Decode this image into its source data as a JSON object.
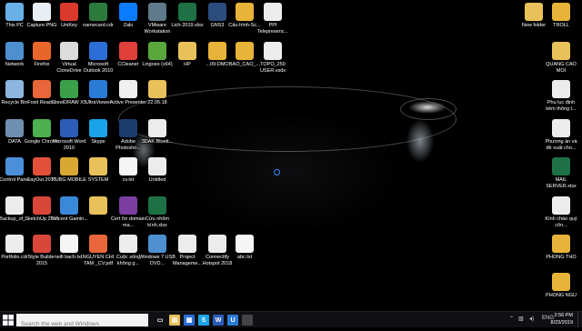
{
  "desktop": {
    "left_column_icons": [
      {
        "label": "This PC",
        "icon": "computer-icon",
        "color": "#6ab0e8"
      },
      {
        "label": "Capture.PNG",
        "icon": "image-file-icon",
        "color": "#e9eef5"
      },
      {
        "label": "UniKey",
        "icon": "unikey-icon",
        "color": "#d93a2b"
      },
      {
        "label": "namecard.cdr",
        "icon": "coreldraw-file-icon",
        "color": "#2d7a3d"
      },
      {
        "label": "Zalo",
        "icon": "zalo-icon",
        "color": "#0a7cff"
      },
      {
        "label": "VMware Workstation",
        "icon": "vmware-icon",
        "color": "#5f7a8a"
      },
      {
        "label": "Lich-2019.xlsx",
        "icon": "excel-file-icon",
        "color": "#1e7145"
      },
      {
        "label": "GNS3",
        "icon": "gns3-icon",
        "color": "#2b4d7e"
      },
      {
        "label": "Cấu-hình-Sc...",
        "icon": "archive-file-icon",
        "color": "#e8b339"
      },
      {
        "label": "PPI Telepresenc...",
        "icon": "document-icon",
        "color": "#ececec"
      },
      {
        "label": "Network",
        "icon": "network-icon",
        "color": "#4e8fd0"
      },
      {
        "label": "Firefox",
        "icon": "firefox-icon",
        "color": "#e8662a"
      },
      {
        "label": "Virtual CloneDrive",
        "icon": "clonedrive-icon",
        "color": "#dcdcdc"
      },
      {
        "label": "Microsoft Outlook 2010",
        "icon": "outlook-icon",
        "color": "#2b6fd6"
      },
      {
        "label": "CCleaner",
        "icon": "ccleaner-icon",
        "color": "#e0403a"
      },
      {
        "label": "Lingoes (x64)",
        "icon": "lingoes-icon",
        "color": "#5aa83b"
      },
      {
        "label": "HP",
        "icon": "folder-icon",
        "color": "#e8c15a"
      },
      {
        "label": "...09-DMO",
        "icon": "archive-file-icon",
        "color": "#e8b339"
      },
      {
        "label": "BAO_CAO_...",
        "icon": "archive-file-icon",
        "color": "#e8b339"
      },
      {
        "label": "TOPO_250 USER.vsdx",
        "icon": "visio-file-icon",
        "color": "#ececec"
      },
      {
        "label": "Recycle Bin",
        "icon": "recycle-bin-icon",
        "color": "#8cb6e0"
      },
      {
        "label": "Foxit Reader",
        "icon": "foxit-reader-icon",
        "color": "#e8663a"
      },
      {
        "label": "CorelDRAW X5",
        "icon": "coreldraw-icon",
        "color": "#3aa04a"
      },
      {
        "label": "UltraViewer",
        "icon": "ultraviewer-icon",
        "color": "#2a7bd6"
      },
      {
        "label": "Active Presenter",
        "icon": "active-presenter-icon",
        "color": "#f0f0f0"
      },
      {
        "label": "22.05.18",
        "icon": "folder-icon",
        "color": "#e8c15a"
      },
      {
        "label": "DATA",
        "icon": "drive-icon",
        "color": "#6f8fb0"
      },
      {
        "label": "Google Chrome",
        "icon": "chrome-icon",
        "color": "#4caf50"
      },
      {
        "label": "Microsoft Word 2010",
        "icon": "word-icon",
        "color": "#2b5cb8"
      },
      {
        "label": "Skype",
        "icon": "skype-icon",
        "color": "#1aa3e8"
      },
      {
        "label": "Adobe Photosho...",
        "icon": "photoshop-icon",
        "color": "#1c3d6e"
      },
      {
        "label": "3DAK Bluett...",
        "icon": "word-file-icon",
        "color": "#ececec"
      },
      {
        "label": "Control Panel",
        "icon": "control-panel-icon",
        "color": "#4b8fd9"
      },
      {
        "label": "LayOut 2015",
        "icon": "layout-icon",
        "color": "#e2503a"
      },
      {
        "label": "PUBG MOBILE",
        "icon": "pubg-icon",
        "color": "#d9a832"
      },
      {
        "label": "SYSTEM",
        "icon": "folder-icon",
        "color": "#e8c15a"
      },
      {
        "label": "cv.txt",
        "icon": "text-file-icon",
        "color": "#f5f5f5"
      },
      {
        "label": "Untitled",
        "icon": "word-file-icon",
        "color": "#ececec"
      },
      {
        "label": "Backup_of_...",
        "icon": "document-icon",
        "color": "#ececec"
      },
      {
        "label": "SketchUp 2015",
        "icon": "sketchup-icon",
        "color": "#d9463a"
      },
      {
        "label": "Tencent Gamin...",
        "icon": "tencent-icon",
        "color": "#3a88d8"
      },
      {
        "label": "",
        "icon": "folder-icon",
        "color": "#e8c15a"
      },
      {
        "label": "Cert for domain ma...",
        "icon": "archive-file-icon",
        "color": "#7a3fa0"
      },
      {
        "label": "Cửu nhôm kính.xlsx",
        "icon": "excel-file-icon",
        "color": "#1e7145"
      },
      {
        "label": "Portfolio.cdr",
        "icon": "coreldraw-file-icon",
        "color": "#ececec"
      },
      {
        "label": "Style Builder 2015",
        "icon": "style-builder-icon",
        "color": "#d9463a"
      },
      {
        "label": "wifi bach.txt",
        "icon": "text-file-icon",
        "color": "#f5f5f5"
      },
      {
        "label": "NGUYEN CHI TAM _CV.pdf",
        "icon": "pdf-file-icon",
        "color": "#e8663a"
      },
      {
        "label": "Cuộc sống không g...",
        "icon": "word-file-icon",
        "color": "#ececec"
      },
      {
        "label": "Windows 7 USB DVD...",
        "icon": "usb-dvd-icon",
        "color": "#4e8fd0"
      },
      {
        "label": "Project Manageme...",
        "icon": "document-icon",
        "color": "#ececec"
      },
      {
        "label": "Connectify Hotspot 2018",
        "icon": "connectify-icon",
        "color": "#ececec"
      },
      {
        "label": "abc.txt",
        "icon": "text-file-icon",
        "color": "#f5f5f5"
      }
    ],
    "right_column_icons": [
      {
        "label": "New folder",
        "icon": "folder-icon",
        "color": "#e8c15a"
      },
      {
        "label": "TROLL",
        "icon": "archive-file-icon",
        "color": "#e8b339"
      },
      {
        "label": "QUANG CAO MOI",
        "icon": "folder-icon",
        "color": "#e8c15a"
      },
      {
        "label": "Phụ lục định kèm thông t...",
        "icon": "word-file-icon",
        "color": "#ececec"
      },
      {
        "label": "Phương án và đề xuất cho...",
        "icon": "word-file-icon",
        "color": "#ececec"
      },
      {
        "label": "MAIL SERVER.xlsx",
        "icon": "excel-file-icon",
        "color": "#1e7145"
      },
      {
        "label": "Kính chào quý côn...",
        "icon": "word-file-icon",
        "color": "#ececec"
      },
      {
        "label": "PHONG THO",
        "icon": "archive-file-icon",
        "color": "#e8b339"
      },
      {
        "label": "PHONG NGU",
        "icon": "archive-file-icon",
        "color": "#e8b339"
      }
    ]
  },
  "taskbar": {
    "search_placeholder": "Search the web and Windows",
    "apps": [
      {
        "icon": "task-view-icon",
        "glyph": "▭",
        "color": "#101014"
      },
      {
        "icon": "file-explorer-icon",
        "glyph": "▤",
        "color": "#e8c15a"
      },
      {
        "icon": "store-icon",
        "glyph": "▦",
        "color": "#2a6fd6"
      },
      {
        "icon": "skype-icon",
        "glyph": "S",
        "color": "#1aa3e8"
      },
      {
        "icon": "word-icon",
        "glyph": "W",
        "color": "#2b5cb8"
      },
      {
        "icon": "ultraviewer-icon",
        "glyph": "U",
        "color": "#2a7bd6"
      },
      {
        "icon": "blank-window-icon",
        "glyph": "",
        "color": "#444"
      }
    ],
    "tray": {
      "language": "ENG",
      "time": "2:56 PM",
      "date": "8/23/2019"
    }
  }
}
